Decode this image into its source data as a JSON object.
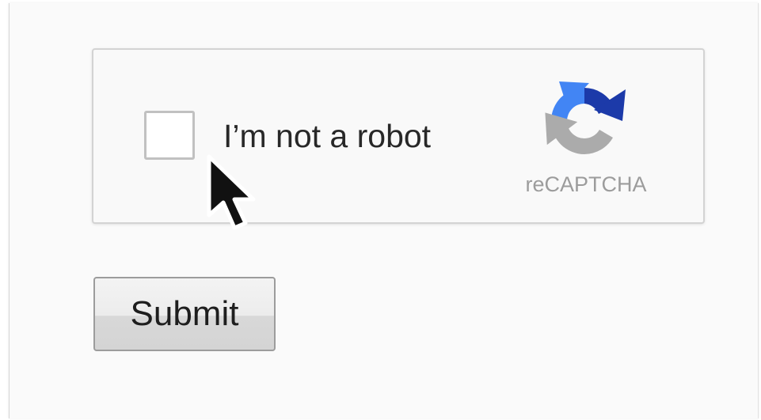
{
  "recaptcha": {
    "checkbox_label": "I’m not a robot",
    "brand": "reCAPTCHA",
    "checked": false,
    "logo_icon": "recaptcha-logo-icon"
  },
  "form": {
    "submit_label": "Submit"
  },
  "pointer": {
    "icon": "mouse-pointer-icon"
  },
  "colors": {
    "logo_blue_dark": "#1c3aa9",
    "logo_blue_light": "#4285f4",
    "logo_gray": "#ababab",
    "label_text": "#282828",
    "brand_text": "#9c9c9c",
    "checkbox_border": "#c1c1c1"
  }
}
